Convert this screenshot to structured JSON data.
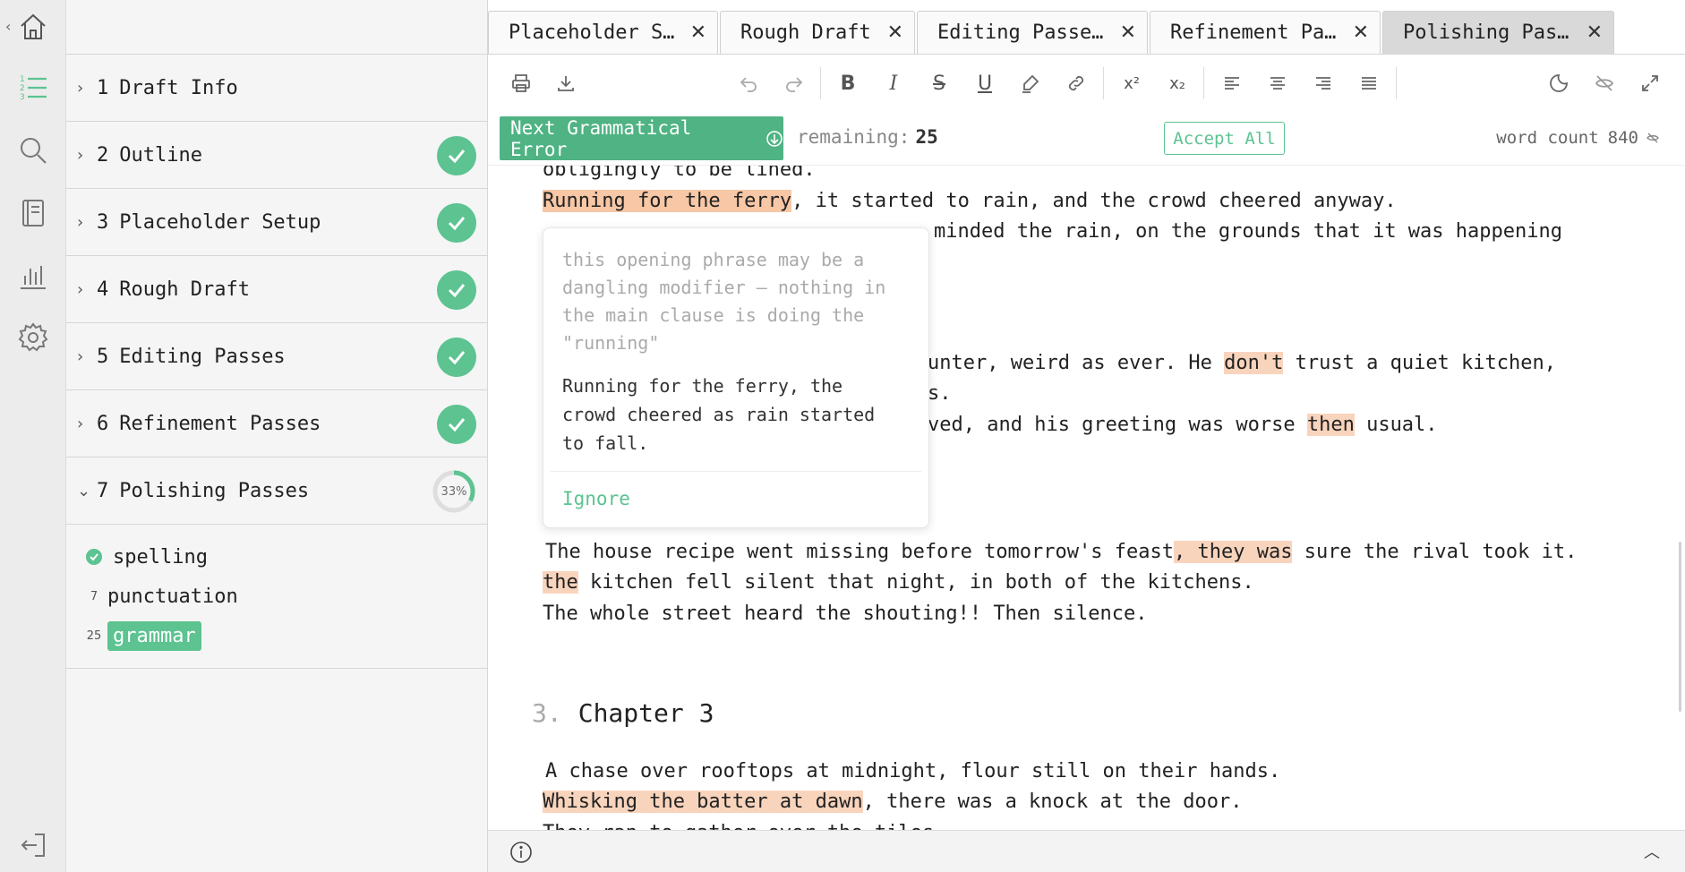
{
  "rail": {
    "icons": [
      "home-icon",
      "outline-list-icon",
      "search-icon",
      "notebook-icon",
      "stats-icon",
      "gear-icon",
      "logout-icon"
    ],
    "accent": "#5cc391"
  },
  "sidebar": {
    "sections": [
      {
        "num": "1",
        "title": "Draft Info",
        "status": "none"
      },
      {
        "num": "2",
        "title": "Outline",
        "status": "done"
      },
      {
        "num": "3",
        "title": "Placeholder Setup",
        "status": "done"
      },
      {
        "num": "4",
        "title": "Rough Draft",
        "status": "done"
      },
      {
        "num": "5",
        "title": "Editing Passes",
        "status": "done"
      },
      {
        "num": "6",
        "title": "Refinement Passes",
        "status": "done"
      },
      {
        "num": "7",
        "title": "Polishing Passes",
        "status": "progress",
        "progress_label": "33%",
        "progress": 0.33
      }
    ],
    "subitems": [
      {
        "label": "spelling",
        "badge": "",
        "state": "done"
      },
      {
        "label": "punctuation",
        "badge": "7",
        "state": "pending"
      },
      {
        "label": "grammar",
        "badge": "25",
        "state": "active"
      }
    ]
  },
  "tabs": [
    {
      "label": "Placeholder S…",
      "active": false
    },
    {
      "label": "Rough Draft",
      "active": false
    },
    {
      "label": "Editing Passe…",
      "active": false
    },
    {
      "label": "Refinement Pa…",
      "active": false
    },
    {
      "label": "Polishing Pas…",
      "active": true
    }
  ],
  "toolbar": {
    "items": [
      "print-icon",
      "download-icon",
      "undo-icon",
      "redo-icon",
      "bold-icon",
      "italic-icon",
      "strikethrough-icon",
      "underline-icon",
      "highlighter-icon",
      "link-icon",
      "superscript-icon",
      "subscript-icon",
      "align-left-icon",
      "align-center-icon",
      "align-right-icon",
      "justify-icon",
      "theme-icon",
      "hide-icon",
      "fullscreen-icon"
    ],
    "bold": "B",
    "italic": "I",
    "strike": "S",
    "underline": "U",
    "sup": "x²",
    "sub": "x₂"
  },
  "grammar_bar": {
    "next_label": "Next Grammatical Error",
    "remaining_label": "remaining:",
    "remaining_value": "25",
    "accept_all": "Accept All",
    "word_count_label": "word count",
    "word_count_value": "840"
  },
  "editor": {
    "line1": "obligingly to be lined.",
    "line2_hl": "Running for the ferry",
    "line2_rest": ", it started to rain, and the crowd cheered anyway.",
    "line3_tail": "minded the rain, on the grounds that it was happening",
    "line4_tail": "unter, weird as ever. He ",
    "line4_hl": "don't",
    "line4_rest": " trust a quiet kitchen,",
    "line5_tail": "s.",
    "line6_tail": "ved, and his greeting was worse ",
    "line6_hl": "then",
    "line6_rest": " usual.",
    "line7_pre": "The house recipe went missing before tomorrow's feast",
    "line7_hl": ", they was",
    "line7_rest": " sure the rival took it.",
    "line8_hl": "the",
    "line8_rest": " kitchen fell silent that night, in both of the kitchens.",
    "line9": "The whole street heard the shouting!! Then silence.",
    "heading_num": "3.",
    "heading_text": "Chapter 3",
    "line10": "A chase over rooftops at midnight, flour still on their hands.",
    "line11_hl": "Whisking the batter at dawn",
    "line11_rest": ", there was a knock at the door.",
    "line12": "They ran to gather over the tiles"
  },
  "popup": {
    "message": "this opening phrase may be a\ndangling modifier — nothing in\nthe main clause is doing the\n\"running\"",
    "suggestion": "Running for the ferry, the\ncrowd cheered as rain started\nto fall.",
    "ignore": "Ignore"
  }
}
